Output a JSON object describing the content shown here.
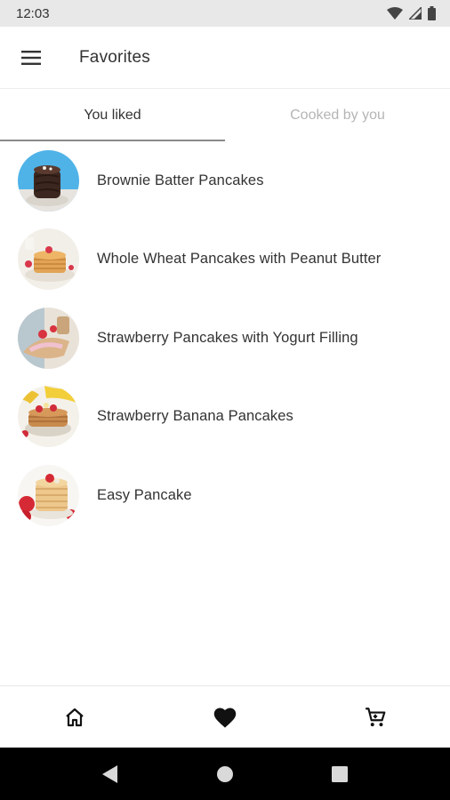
{
  "status_bar": {
    "time": "12:03"
  },
  "app_bar": {
    "title": "Favorites"
  },
  "tabs": [
    {
      "label": "You liked",
      "active": true
    },
    {
      "label": "Cooked by you",
      "active": false
    }
  ],
  "recipes": [
    {
      "name": "Brownie Batter Pancakes"
    },
    {
      "name": "Whole Wheat Pancakes with Peanut Butter"
    },
    {
      "name": "Strawberry Pancakes with Yogurt Filling"
    },
    {
      "name": "Strawberry Banana Pancakes"
    },
    {
      "name": "Easy Pancake"
    }
  ],
  "bottom_nav": [
    {
      "icon": "home-icon"
    },
    {
      "icon": "heart-icon",
      "active": true
    },
    {
      "icon": "cart-icon"
    }
  ],
  "system_nav": [
    {
      "icon": "back-icon"
    },
    {
      "icon": "home-circle-icon"
    },
    {
      "icon": "recents-icon"
    }
  ]
}
